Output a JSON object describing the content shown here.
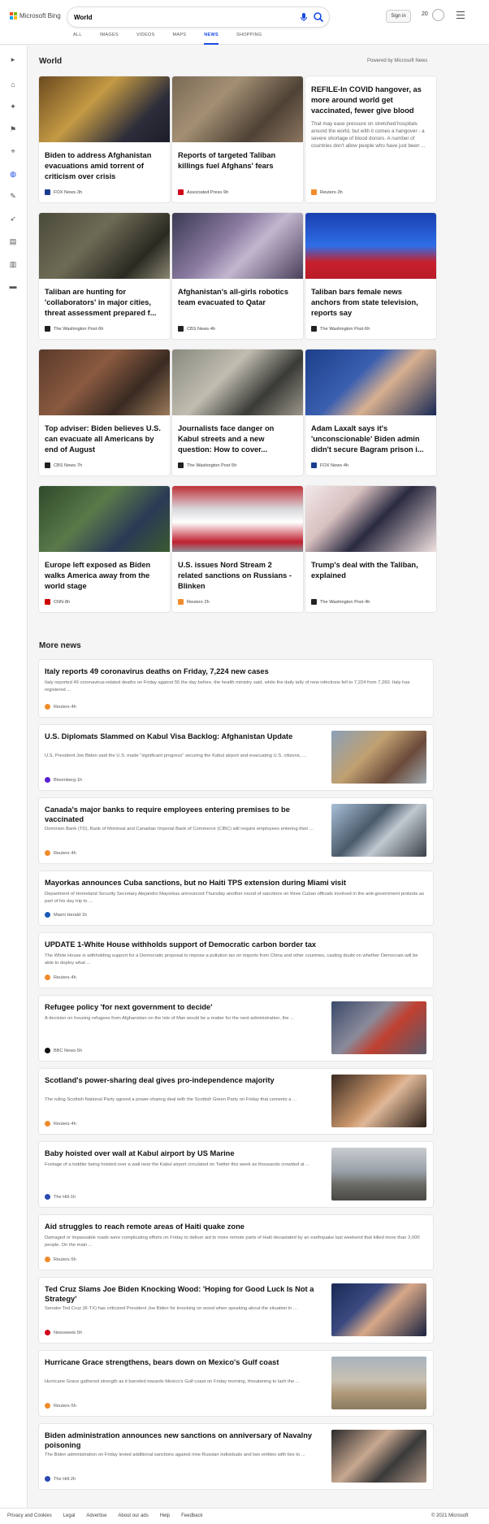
{
  "brand": {
    "name": "Microsoft Bing",
    "colors": [
      "#f25022",
      "#7fba00",
      "#00a4ef",
      "#ffb900"
    ]
  },
  "search": {
    "value": "World"
  },
  "header": {
    "signin_label": "Sign in",
    "rewards_count": "20"
  },
  "tabs": [
    "ALL",
    "IMAGES",
    "VIDEOS",
    "MAPS",
    "NEWS",
    "SHOPPING"
  ],
  "active_tab": "NEWS",
  "sidebar_icons": [
    "chevron-right-icon",
    "home-icon",
    "spark-icon",
    "flag-icon",
    "location-pin-icon",
    "globe-icon",
    "wrench-icon",
    "rocket-icon",
    "film-icon",
    "building-icon",
    "card-icon"
  ],
  "world": {
    "title": "World",
    "powered": "Powered by Microsoft News"
  },
  "cards": [
    {
      "title": "Biden to address Afghanistan evacuations amid torrent of criticism over crisis",
      "source": "FOX News",
      "age": "3h",
      "src_color": "#1a3d8f",
      "thumb": "linear-gradient(135deg,#6b4a1f 0%,#c49a44 40%,#2c2c3a 75%,#1d1d2a 100%)",
      "has_thumb": true
    },
    {
      "title": "Reports of targeted Taliban killings fuel Afghans' fears",
      "source": "Associated Press",
      "age": "9h",
      "src_color": "#d0021b",
      "thumb": "linear-gradient(135deg,#7a6a55 0%,#a38f73 35%,#4e4236 70%,#8c7560 100%)",
      "has_thumb": true
    },
    {
      "title": "REFILE-In COVID hangover, as more around world get vaccinated, fewer give blood",
      "snippet": "That may ease pressure on stretched hospitals around the world, but with it comes a hangover - a severe shortage of blood donors. A number of countries don't allow people who have just been ...",
      "source": "Reuters",
      "age": "3h",
      "src_color": "#f08c2a",
      "has_thumb": false
    },
    {
      "title": "Taliban are hunting for 'collaborators' in major cities, threat assessment prepared f...",
      "source": "The Washington Post",
      "age": "6h",
      "src_color": "#222",
      "thumb": "linear-gradient(135deg,#4a4a3a 0%,#6e6b55 40%,#2a2a22 75%,#8a8670 100%)",
      "has_thumb": true
    },
    {
      "title": "Afghanistan's all-girls robotics team evacuated to Qatar",
      "source": "CBS News",
      "age": "4h",
      "src_color": "#222",
      "thumb": "linear-gradient(135deg,#3a3a52 0%,#8a7aa0 40%,#c2b6cf 60%,#4a3f5a 100%)",
      "has_thumb": true
    },
    {
      "title": "Taliban bars female news anchors from state television, reports say",
      "source": "The Washington Post",
      "age": "6h",
      "src_color": "#222",
      "thumb": "linear-gradient(180deg,#1a3fb0 0%,#2f6ee6 50%,#c8202c 75%,#b81c28 100%)",
      "has_thumb": true
    },
    {
      "title": "Top adviser: Biden believes U.S. can evacuate all Americans by end of August",
      "source": "CBS News",
      "age": "7h",
      "src_color": "#222",
      "thumb": "linear-gradient(135deg,#5a3a2a 0%,#8a5a40 40%,#3a2a22 70%,#9a7a5a 100%)",
      "has_thumb": true
    },
    {
      "title": "Journalists face danger on Kabul streets and a new question: How to cover...",
      "source": "The Washington Post",
      "age": "5h",
      "src_color": "#222",
      "thumb": "linear-gradient(135deg,#8a8a80 0%,#c0bdb0 40%,#3a3a36 70%,#9a968a 100%)",
      "has_thumb": true
    },
    {
      "title": "Adam Laxalt says it's 'unconscionable' Biden admin didn't secure Bagram prison i...",
      "source": "FOX News",
      "age": "4h",
      "src_color": "#1a3d8f",
      "thumb": "linear-gradient(135deg,#1d3f8a 0%,#3a5fb0 40%,#d8b090 60%,#1a2a55 100%)",
      "has_thumb": true
    },
    {
      "title": "Europe left exposed as Biden walks America away from the world stage",
      "source": "CNN",
      "age": "8h",
      "src_color": "#cc0000",
      "thumb": "linear-gradient(135deg,#2e4a2a 0%,#5a7a4a 40%,#2a3a55 70%,#3a5a30 100%)",
      "has_thumb": true
    },
    {
      "title": "U.S. issues Nord Stream 2 related sanctions on Russians - Blinken",
      "source": "Reuters",
      "age": "2h",
      "src_color": "#f08c2a",
      "thumb": "linear-gradient(180deg,#c03038 0%,#d8d8dc 35%,#ffffff 55%,#c02030 85%,#909098 100%)",
      "has_thumb": true
    },
    {
      "title": "Trump's deal with the Taliban, explained",
      "source": "The Washington Post",
      "age": "4h",
      "src_color": "#222",
      "thumb": "linear-gradient(135deg,#f2e8e8 0%,#d8c0c0 30%,#2a2a40 55%,#f0e0e0 100%)",
      "has_thumb": true
    }
  ],
  "more_news": {
    "title": "More news"
  },
  "items": [
    {
      "title": "Italy reports 49 coronavirus deaths on Friday, 7,224 new cases",
      "snippet": "Italy reported 49 coronavirus-related deaths on Friday against 55 the day before, the health ministry said, while the daily tally of new infections fell to 7,224 from 7,260. Italy has registered ...",
      "source": "Reuters",
      "age": "4h",
      "src_color": "#f08c2a",
      "has_thumb": false
    },
    {
      "title": "U.S. Diplomats Slammed on Kabul Visa Backlog: Afghanistan Update",
      "snippet": "U.S. President Joe Biden said the U.S. made \"significant progress\" securing the Kabul airport and evacuating U.S. citizens, ...",
      "source": "Bloomberg",
      "age": "1h",
      "src_color": "#5a1fd1",
      "thumb": "linear-gradient(135deg,#8aa0b8 0%,#c0a070 40%,#6a4a3a 70%,#a0aab0 100%)",
      "has_thumb": true
    },
    {
      "title": "Canada's major banks to require employees entering premises to be vaccinated",
      "snippet": "Dominion Bank (TD), Bank of Montreal and Canadian Imperial Bank of Commerce (CIBC) will require employees entering their ...",
      "source": "Reuters",
      "age": "4h",
      "src_color": "#f08c2a",
      "thumb": "linear-gradient(135deg,#a8c0d8 0%,#4a5a6a 40%,#c0c8d0 60%,#3a4048 100%)",
      "has_thumb": true
    },
    {
      "title": "Mayorkas announces Cuba sanctions, but no Haiti TPS extension during Miami visit",
      "snippet": "Department of Homeland Security Secretary Alejandro Mayorkas announced Thursday another round of sanctions on three Cuban officials involved in the anti-government protests as part of his day trip to ...",
      "source": "Miami Herald",
      "age": "1h",
      "src_color": "#1a5ab8",
      "has_thumb": false
    },
    {
      "title": "UPDATE 1-White House withholds support of Democratic carbon border tax",
      "snippet": "The White House is withholding support for a Democratic proposal to impose a pollution tax on imports from China and other countries, casting doubt on whether Democrats will be able to deploy what ...",
      "source": "Reuters",
      "age": "4h",
      "src_color": "#f08c2a",
      "has_thumb": false
    },
    {
      "title": "Refugee policy 'for next government to decide'",
      "snippet": "A decision on housing refugees from Afghanistan on the Isle of Man would be a matter for the next administration, the ...",
      "source": "BBC News",
      "age": "5h",
      "src_color": "#111",
      "thumb": "linear-gradient(135deg,#3a4a6a 0%,#8a8a9a 40%,#c04030 60%,#5a5a6a 100%)",
      "has_thumb": true
    },
    {
      "title": "Scotland's power-sharing deal gives pro-independence majority",
      "snippet": "The ruling Scottish National Party agreed a power-sharing deal with the Scottish Green Party on Friday that cements a ...",
      "source": "Reuters",
      "age": "4h",
      "src_color": "#f08c2a",
      "thumb": "linear-gradient(135deg,#3a2a22 0%,#c8956a 45%,#e0b898 55%,#2a1e18 100%)",
      "has_thumb": true
    },
    {
      "title": "Baby hoisted over wall at Kabul airport by US Marine",
      "snippet": "Footage of a toddler being hoisted over a wall near the Kabul airport circulated on Twitter this week as thousands crowded at ...",
      "source": "The Hill",
      "age": "1h",
      "src_color": "#2a4ab0",
      "thumb": "linear-gradient(180deg,#c8ccd0 0%,#9aa0a8 45%,#6a6a66 70%,#4a4842 100%)",
      "has_thumb": true
    },
    {
      "title": "Aid struggles to reach remote areas of Haiti quake zone",
      "snippet": "Damaged or impassable roads were complicating efforts on Friday to deliver aid to more remote parts of Haiti devastated by an earthquake last weekend that killed more than 2,000 people. On the main ...",
      "source": "Reuters",
      "age": "5h",
      "src_color": "#f08c2a",
      "has_thumb": false
    },
    {
      "title": "Ted Cruz Slams Joe Biden Knocking Wood: 'Hoping for Good Luck Is Not a Strategy'",
      "snippet": "Senator Ted Cruz (R-TX) has criticized President Joe Biden for knocking on wood when speaking about the situation in ...",
      "source": "Newsweek",
      "age": "5h",
      "src_color": "#d0021b",
      "thumb": "linear-gradient(135deg,#1a2a55 0%,#3a4a80 35%,#d8a888 55%,#1a2240 100%)",
      "has_thumb": true
    },
    {
      "title": "Hurricane Grace strengthens, bears down on Mexico's Gulf coast",
      "snippet": "Hurricane Grace gathered strength as it barreled towards Mexico's Gulf coast on Friday morning, threatening to lash the ...",
      "source": "Reuters",
      "age": "5h",
      "src_color": "#f08c2a",
      "thumb": "linear-gradient(180deg,#a8b4c0 0%,#c8c0b0 45%,#b09878 70%,#8a7a60 100%)",
      "has_thumb": true
    },
    {
      "title": "Biden administration announces new sanctions on anniversary of Navalny poisoning",
      "snippet": "The Biden administration on Friday levied additional sanctions against nine Russian individuals and two entities with ties to ...",
      "source": "The Hill",
      "age": "2h",
      "src_color": "#2a4ab0",
      "thumb": "linear-gradient(135deg,#2a2a2a 0%,#c8a890 40%,#3a3a3a 65%,#a89080 100%)",
      "has_thumb": true
    }
  ],
  "footer": {
    "links": [
      "Privacy and Cookies",
      "Legal",
      "Advertise",
      "About our ads",
      "Help",
      "Feedback"
    ],
    "copyright": "© 2021 Microsoft"
  }
}
